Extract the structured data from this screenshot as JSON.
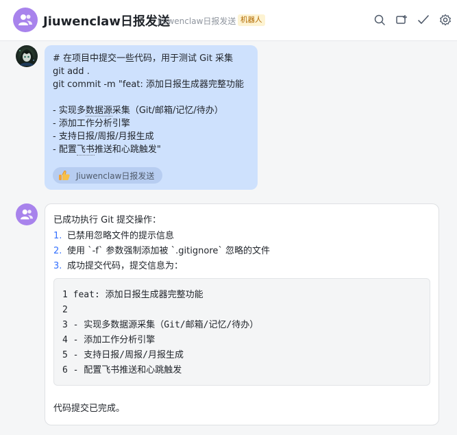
{
  "header": {
    "title": "Jiuwenclaw日报发送",
    "subtitle": "Jiuwenclaw日报发送",
    "bot_badge": "机器人",
    "tools": [
      "search-icon",
      "add-tab-icon",
      "checkmark-icon",
      "settings-icon"
    ]
  },
  "messages": {
    "user": {
      "lines": [
        "# 在项目中提交一些代码，用于测试 Git 采集",
        "git add .",
        "git commit -m \"feat: 添加日报生成器完整功能",
        "",
        "- 实现多数据源采集（Git/邮箱/记忆/待办）",
        "- 添加工作分析引擎",
        "- 支持日报/周报/月报生成",
        "- 配置飞书推送和心跳触发\""
      ],
      "line5_plain_a": "- 实现多",
      "line5_dotted": "数据源",
      "line5_plain_b": "采集（Git/邮箱/记忆/待办）",
      "line8_plain_a": "- 配置",
      "line8_dotted": "飞书",
      "line8_plain_b": "推送和心跳触发\"",
      "reaction": {
        "icon": "thumbs-up-icon",
        "label": "Jiuwenclaw日报发送"
      }
    },
    "bot": {
      "intro": "已成功执行 Git 提交操作：",
      "steps": [
        {
          "num": "1.",
          "text": "已禁用忽略文件的提示信息"
        },
        {
          "num": "2.",
          "text": "使用 `-f` 参数强制添加被 `.gitignore` 忽略的文件"
        },
        {
          "num": "3.",
          "text": "成功提交代码，提交信息为："
        }
      ],
      "code_lines": [
        "1 feat: 添加日报生成器完整功能",
        "2",
        "3 - 实现多数据源采集（Git/邮箱/记忆/待办）",
        "4 - 添加工作分析引擎",
        "5 - 支持日报/周报/月报生成",
        "6 - 配置飞书推送和心跳触发"
      ],
      "outro": "代码提交已完成。"
    }
  },
  "colors": {
    "accent_purple": "#a883ec",
    "user_bubble": "#cee1fd",
    "list_number": "#3370ff",
    "badge_bg": "#fdf3d2",
    "badge_text": "#b26a00"
  }
}
